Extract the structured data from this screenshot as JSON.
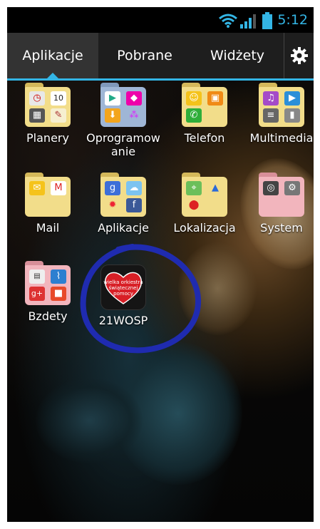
{
  "status": {
    "time": "5:12",
    "accent": "#33b5e5"
  },
  "tabs": [
    {
      "label": "Aplikacje",
      "active": true
    },
    {
      "label": "Pobrane"
    },
    {
      "label": "Widżety"
    }
  ],
  "settings_icon": "gear-icon",
  "apps": [
    {
      "label": "Planery",
      "folder_color": "#f2dd8a",
      "icons": [
        "clock-icon",
        "calendar-icon",
        "calculator-icon",
        "notes-icon"
      ]
    },
    {
      "label": "Oprogramow anie",
      "folder_color": "#9fb6d6",
      "icons": [
        "play-store-icon",
        "apps-icon",
        "download-icon",
        "molecule-icon"
      ]
    },
    {
      "label": "Telefon",
      "folder_color": "#f2dd8a",
      "icons": [
        "messaging-icon",
        "contacts-icon",
        "phone-icon"
      ]
    },
    {
      "label": "Multimedia",
      "folder_color": "#f2dd8a",
      "icons": [
        "music-icon",
        "video-icon",
        "radio-icon",
        "media-player-icon"
      ]
    },
    {
      "label": "Mail",
      "folder_color": "#f2dd8a",
      "icons": [
        "email-icon",
        "gmail-icon"
      ]
    },
    {
      "label": "Aplikacje",
      "folder_color": "#f2dd8a",
      "icons": [
        "google-search-icon",
        "weather-icon",
        "sun-icon",
        "facebook-icon"
      ]
    },
    {
      "label": "Lokalizacja",
      "folder_color": "#f2dd8a",
      "icons": [
        "maps-icon",
        "navigation-icon",
        "location-pin-icon"
      ]
    },
    {
      "label": "System",
      "folder_color": "#f2b5bd",
      "icons": [
        "disk-icon",
        "settings-icon"
      ]
    },
    {
      "label": "Bzdety",
      "folder_color": "#f2b5bd",
      "icons": [
        "news-icon",
        "stocks-icon",
        "google-plus-icon",
        "messenger-icon"
      ]
    },
    {
      "label": "21WOSP",
      "icon_text": [
        "wielka orkiestra",
        "świątecznej",
        "pomocy"
      ]
    }
  ],
  "annotation_color": "#1f2bb0"
}
